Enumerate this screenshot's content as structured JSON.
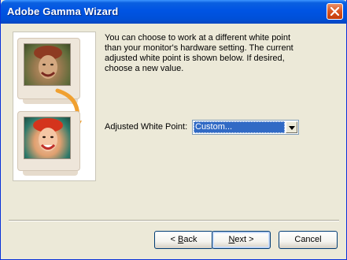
{
  "window": {
    "title": "Adobe Gamma Wizard",
    "titlebar_color": "#0054E3"
  },
  "description": {
    "lines": [
      "You can choose to work at a different white point",
      "than your monitor's hardware setting. The current",
      "adjusted white point is shown below. If desired,",
      "choose a new value."
    ]
  },
  "white_point": {
    "label": "Adjusted White Point:",
    "selected_value": "Custom...",
    "highlight_color": "#316AC5"
  },
  "buttons": {
    "back": {
      "prefix": "< ",
      "mnemonic": "B",
      "rest": "ack"
    },
    "next": {
      "mnemonic": "N",
      "rest": "ext >"
    },
    "cancel": "Cancel"
  },
  "icons": [
    "close-icon",
    "dropdown-arrow-icon",
    "monitor-icon",
    "curved-arrow-icon"
  ]
}
